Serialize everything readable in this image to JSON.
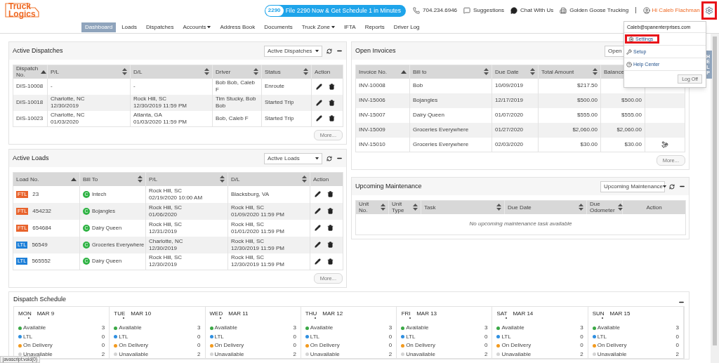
{
  "header": {
    "logo": [
      "Truck",
      "Logics"
    ],
    "promo": {
      "badge": "2290",
      "label": "File 2290 Now & Get Schedule 1 in Minutes"
    },
    "links": [
      {
        "kind": "phone",
        "label": "704.234.6946"
      },
      {
        "kind": "suggestions",
        "label": "Suggestions"
      },
      {
        "kind": "chat",
        "label": "Chat With Us"
      },
      {
        "kind": "company",
        "label": "Golden Goose Trucking"
      }
    ],
    "separator": "|",
    "user": "Hi Caleb Flachman",
    "settings_highlighted": true
  },
  "nav": [
    {
      "label": "Dashboard",
      "selected": true,
      "has_menu": false
    },
    {
      "label": "Loads",
      "selected": false,
      "has_menu": false
    },
    {
      "label": "Dispatches",
      "selected": false,
      "has_menu": false
    },
    {
      "label": "Accounts",
      "selected": false,
      "has_menu": true
    },
    {
      "label": "Address Book",
      "selected": false,
      "has_menu": false
    },
    {
      "label": "Documents",
      "selected": false,
      "has_menu": false
    },
    {
      "label": "Truck Zone",
      "selected": false,
      "has_menu": true
    },
    {
      "label": "IFTA",
      "selected": false,
      "has_menu": false
    },
    {
      "label": "Reports",
      "selected": false,
      "has_menu": false
    },
    {
      "label": "Driver Log",
      "selected": false,
      "has_menu": false
    }
  ],
  "user_menu": {
    "email": "Caleb@spanenterprises.com",
    "items": [
      {
        "kind": "settings",
        "label": "Settings",
        "highlighted": true
      },
      {
        "kind": "setup",
        "label": "Setup",
        "highlighted": false
      },
      {
        "kind": "help",
        "label": "Help Center",
        "highlighted": false
      }
    ],
    "log_off": "Log Off"
  },
  "help_tab": "HELP",
  "active_dispatches": {
    "title": "Active Dispatches",
    "select": "Active Dispatches",
    "more": "More...",
    "columns": [
      {
        "label": "Dispatch No.",
        "kind": "sorted"
      },
      {
        "label": "P/L",
        "kind": "sortable"
      },
      {
        "label": "D/L",
        "kind": "sortable"
      },
      {
        "label": "Driver",
        "kind": "sortable"
      },
      {
        "label": "Status",
        "kind": "sortable"
      },
      {
        "label": "Action",
        "kind": "plain"
      }
    ],
    "rows": [
      {
        "no": "DIS-10008",
        "pl": [
          "-"
        ],
        "dl": [
          "-"
        ],
        "driver": "Bob Bob, Caleb F",
        "status": "Enroute"
      },
      {
        "no": "DIS-10018",
        "pl": [
          "Charlotte, NC",
          "12/30/2019"
        ],
        "dl": [
          "Rock Hill, SC",
          "12/30/2019 11:59 PM"
        ],
        "driver": "Tim Stucky, Bob Bob",
        "status": "Started Trip"
      },
      {
        "no": "DIS-10023",
        "pl": [
          "Charlotte, NC",
          "01/03/2020"
        ],
        "dl": [
          "Atlanta, GA",
          "01/03/2020 11:59 PM"
        ],
        "driver": "Bob, Caleb F",
        "status": "Started Trip"
      }
    ]
  },
  "active_loads": {
    "title": "Active Loads",
    "select": "Active Loads",
    "more": "More...",
    "columns": [
      {
        "label": "Load No.",
        "kind": "sorted"
      },
      {
        "label": "Bill To",
        "kind": "sortable"
      },
      {
        "label": "P/L",
        "kind": "sortable"
      },
      {
        "label": "D/L",
        "kind": "sortable"
      },
      {
        "label": "Action",
        "kind": "plain"
      }
    ],
    "rows": [
      {
        "type": "FTL",
        "color": "#e8632c",
        "no": "23",
        "badge": "C",
        "bill_to": "Intech",
        "pl": [
          "Rock Hill, SC",
          "02/19/2020 10:00 AM"
        ],
        "dl": [
          "Blacksburg, VA"
        ]
      },
      {
        "type": "FTL",
        "color": "#e8632c",
        "no": "454232",
        "badge": "C",
        "bill_to": "Bojangles",
        "pl": [
          "Rock Hill, SC",
          "01/06/2020"
        ],
        "dl": [
          "Rock Hill, SC",
          "01/09/2020 11:59 PM"
        ]
      },
      {
        "type": "FTL",
        "color": "#e8632c",
        "no": "654684",
        "badge": "C",
        "bill_to": "Dairy Queen",
        "pl": [
          "Rock Hill, SC",
          "12/31/2019"
        ],
        "dl": [
          "Rock Hill, SC",
          "01/01/2020 11:59 PM"
        ]
      },
      {
        "type": "LTL",
        "color": "#1d7fd8",
        "no": "56549",
        "badge": "C",
        "bill_to": "Groceries Everywhere",
        "pl": [
          "Charlotte, NC",
          "12/30/2019"
        ],
        "dl": [
          "Rock Hill, SC",
          "12/30/2019 11:59 PM"
        ]
      },
      {
        "type": "LTL",
        "color": "#1d7fd8",
        "no": "565552",
        "badge": "C",
        "bill_to": "Dairy Queen",
        "pl": [
          "Rock Hill, SC",
          "12/30/2019"
        ],
        "dl": [
          "Rock Hill, SC",
          "12/30/2019 11:59 PM"
        ]
      }
    ]
  },
  "open_invoices": {
    "title": "Open Invoices",
    "select": "Open",
    "more": "More...",
    "columns": [
      {
        "label": "Invoice No.",
        "kind": "sorted"
      },
      {
        "label": "Bill to",
        "kind": "sortable"
      },
      {
        "label": "Due Date",
        "kind": "sortable"
      },
      {
        "label": "Total Amount",
        "kind": "sortable"
      },
      {
        "label": "Balance",
        "kind": "plain"
      }
    ],
    "rows": [
      {
        "no": "INV-10008",
        "bill_to": "Bob",
        "due": "10/09/2019",
        "total": "$217.50",
        "payment_icon": false
      },
      {
        "no": "INV-15006",
        "bill_to": "Bojangles",
        "due": "12/17/2019",
        "total": "$500.00",
        "balance": "$500.00",
        "payment_icon": false
      },
      {
        "no": "INV-15007",
        "bill_to": "Dairy Queen",
        "due": "01/07/2020",
        "total": "$555.00",
        "balance": "$555.00",
        "payment_icon": false
      },
      {
        "no": "INV-15009",
        "bill_to": "Groceries Everywhere",
        "due": "01/27/2020",
        "total": "$2,060.00",
        "balance": "$2,060.00",
        "payment_icon": false
      },
      {
        "no": "INV-15010",
        "bill_to": "Groceries Everywhere",
        "due": "02/03/2020",
        "total": "$30.00",
        "balance": "$30.00",
        "payment_icon": true
      }
    ]
  },
  "upcoming_maintenance": {
    "title": "Upcoming Maintenance",
    "select": "Upcoming Maintenance",
    "columns": [
      {
        "label": "Unit No.",
        "kind": "sortable"
      },
      {
        "label": "Unit Type",
        "kind": "sortable"
      },
      {
        "label": "Task",
        "kind": "sortable"
      },
      {
        "label": "Due Date",
        "kind": "sortable"
      },
      {
        "label": "Due Odometer",
        "kind": "sortable"
      },
      {
        "label": "Action",
        "kind": "plain"
      }
    ],
    "empty": "No upcoming maintenance task available"
  },
  "dispatch_schedule": {
    "title": "Dispatch Schedule",
    "days": [
      {
        "day": "MON",
        "date": "MAR 9",
        "items": [
          {
            "label": "Available",
            "count": "3",
            "color": "#3aa845"
          },
          {
            "label": "LTL",
            "count": "0",
            "color": "#2f8fe0"
          },
          {
            "label": "On Delivery",
            "count": "0",
            "color": "#f29a1f"
          },
          {
            "label": "Unavailable",
            "count": "2",
            "color": "#d4d4d4"
          }
        ]
      },
      {
        "day": "TUE",
        "date": "MAR 10",
        "items": [
          {
            "label": "Available",
            "count": "3",
            "color": "#3aa845"
          },
          {
            "label": "LTL",
            "count": "0",
            "color": "#2f8fe0"
          },
          {
            "label": "On Delivery",
            "count": "0",
            "color": "#f29a1f"
          },
          {
            "label": "Unavailable",
            "count": "2",
            "color": "#d4d4d4"
          }
        ]
      },
      {
        "day": "WED",
        "date": "MAR 11",
        "items": [
          {
            "label": "Available",
            "count": "3",
            "color": "#3aa845"
          },
          {
            "label": "LTL",
            "count": "0",
            "color": "#2f8fe0"
          },
          {
            "label": "On Delivery",
            "count": "0",
            "color": "#f29a1f"
          },
          {
            "label": "Unavailable",
            "count": "2",
            "color": "#d4d4d4"
          }
        ]
      },
      {
        "day": "THU",
        "date": "MAR 12",
        "items": [
          {
            "label": "Available",
            "count": "3",
            "color": "#3aa845"
          },
          {
            "label": "LTL",
            "count": "0",
            "color": "#2f8fe0"
          },
          {
            "label": "On Delivery",
            "count": "0",
            "color": "#f29a1f"
          },
          {
            "label": "Unavailable",
            "count": "2",
            "color": "#d4d4d4"
          }
        ]
      },
      {
        "day": "FRI",
        "date": "MAR 13",
        "items": [
          {
            "label": "Available",
            "count": "3",
            "color": "#3aa845"
          },
          {
            "label": "LTL",
            "count": "0",
            "color": "#2f8fe0"
          },
          {
            "label": "On Delivery",
            "count": "0",
            "color": "#f29a1f"
          },
          {
            "label": "Unavailable",
            "count": "2",
            "color": "#d4d4d4"
          }
        ]
      },
      {
        "day": "SAT",
        "date": "MAR 14",
        "items": [
          {
            "label": "Available",
            "count": "3",
            "color": "#3aa845"
          },
          {
            "label": "LTL",
            "count": "0",
            "color": "#2f8fe0"
          },
          {
            "label": "On Delivery",
            "count": "0",
            "color": "#f29a1f"
          },
          {
            "label": "Unavailable",
            "count": "2",
            "color": "#d4d4d4"
          }
        ]
      },
      {
        "day": "SUN",
        "date": "MAR 15",
        "items": [
          {
            "label": "Available",
            "count": "3",
            "color": "#3aa845"
          },
          {
            "label": "LTL",
            "count": "0",
            "color": "#2f8fe0"
          },
          {
            "label": "On Delivery",
            "count": "0",
            "color": "#f29a1f"
          },
          {
            "label": "Unavailable",
            "count": "2",
            "color": "#d4d4d4"
          }
        ]
      }
    ]
  },
  "status_bar": "javascript:void(0)"
}
